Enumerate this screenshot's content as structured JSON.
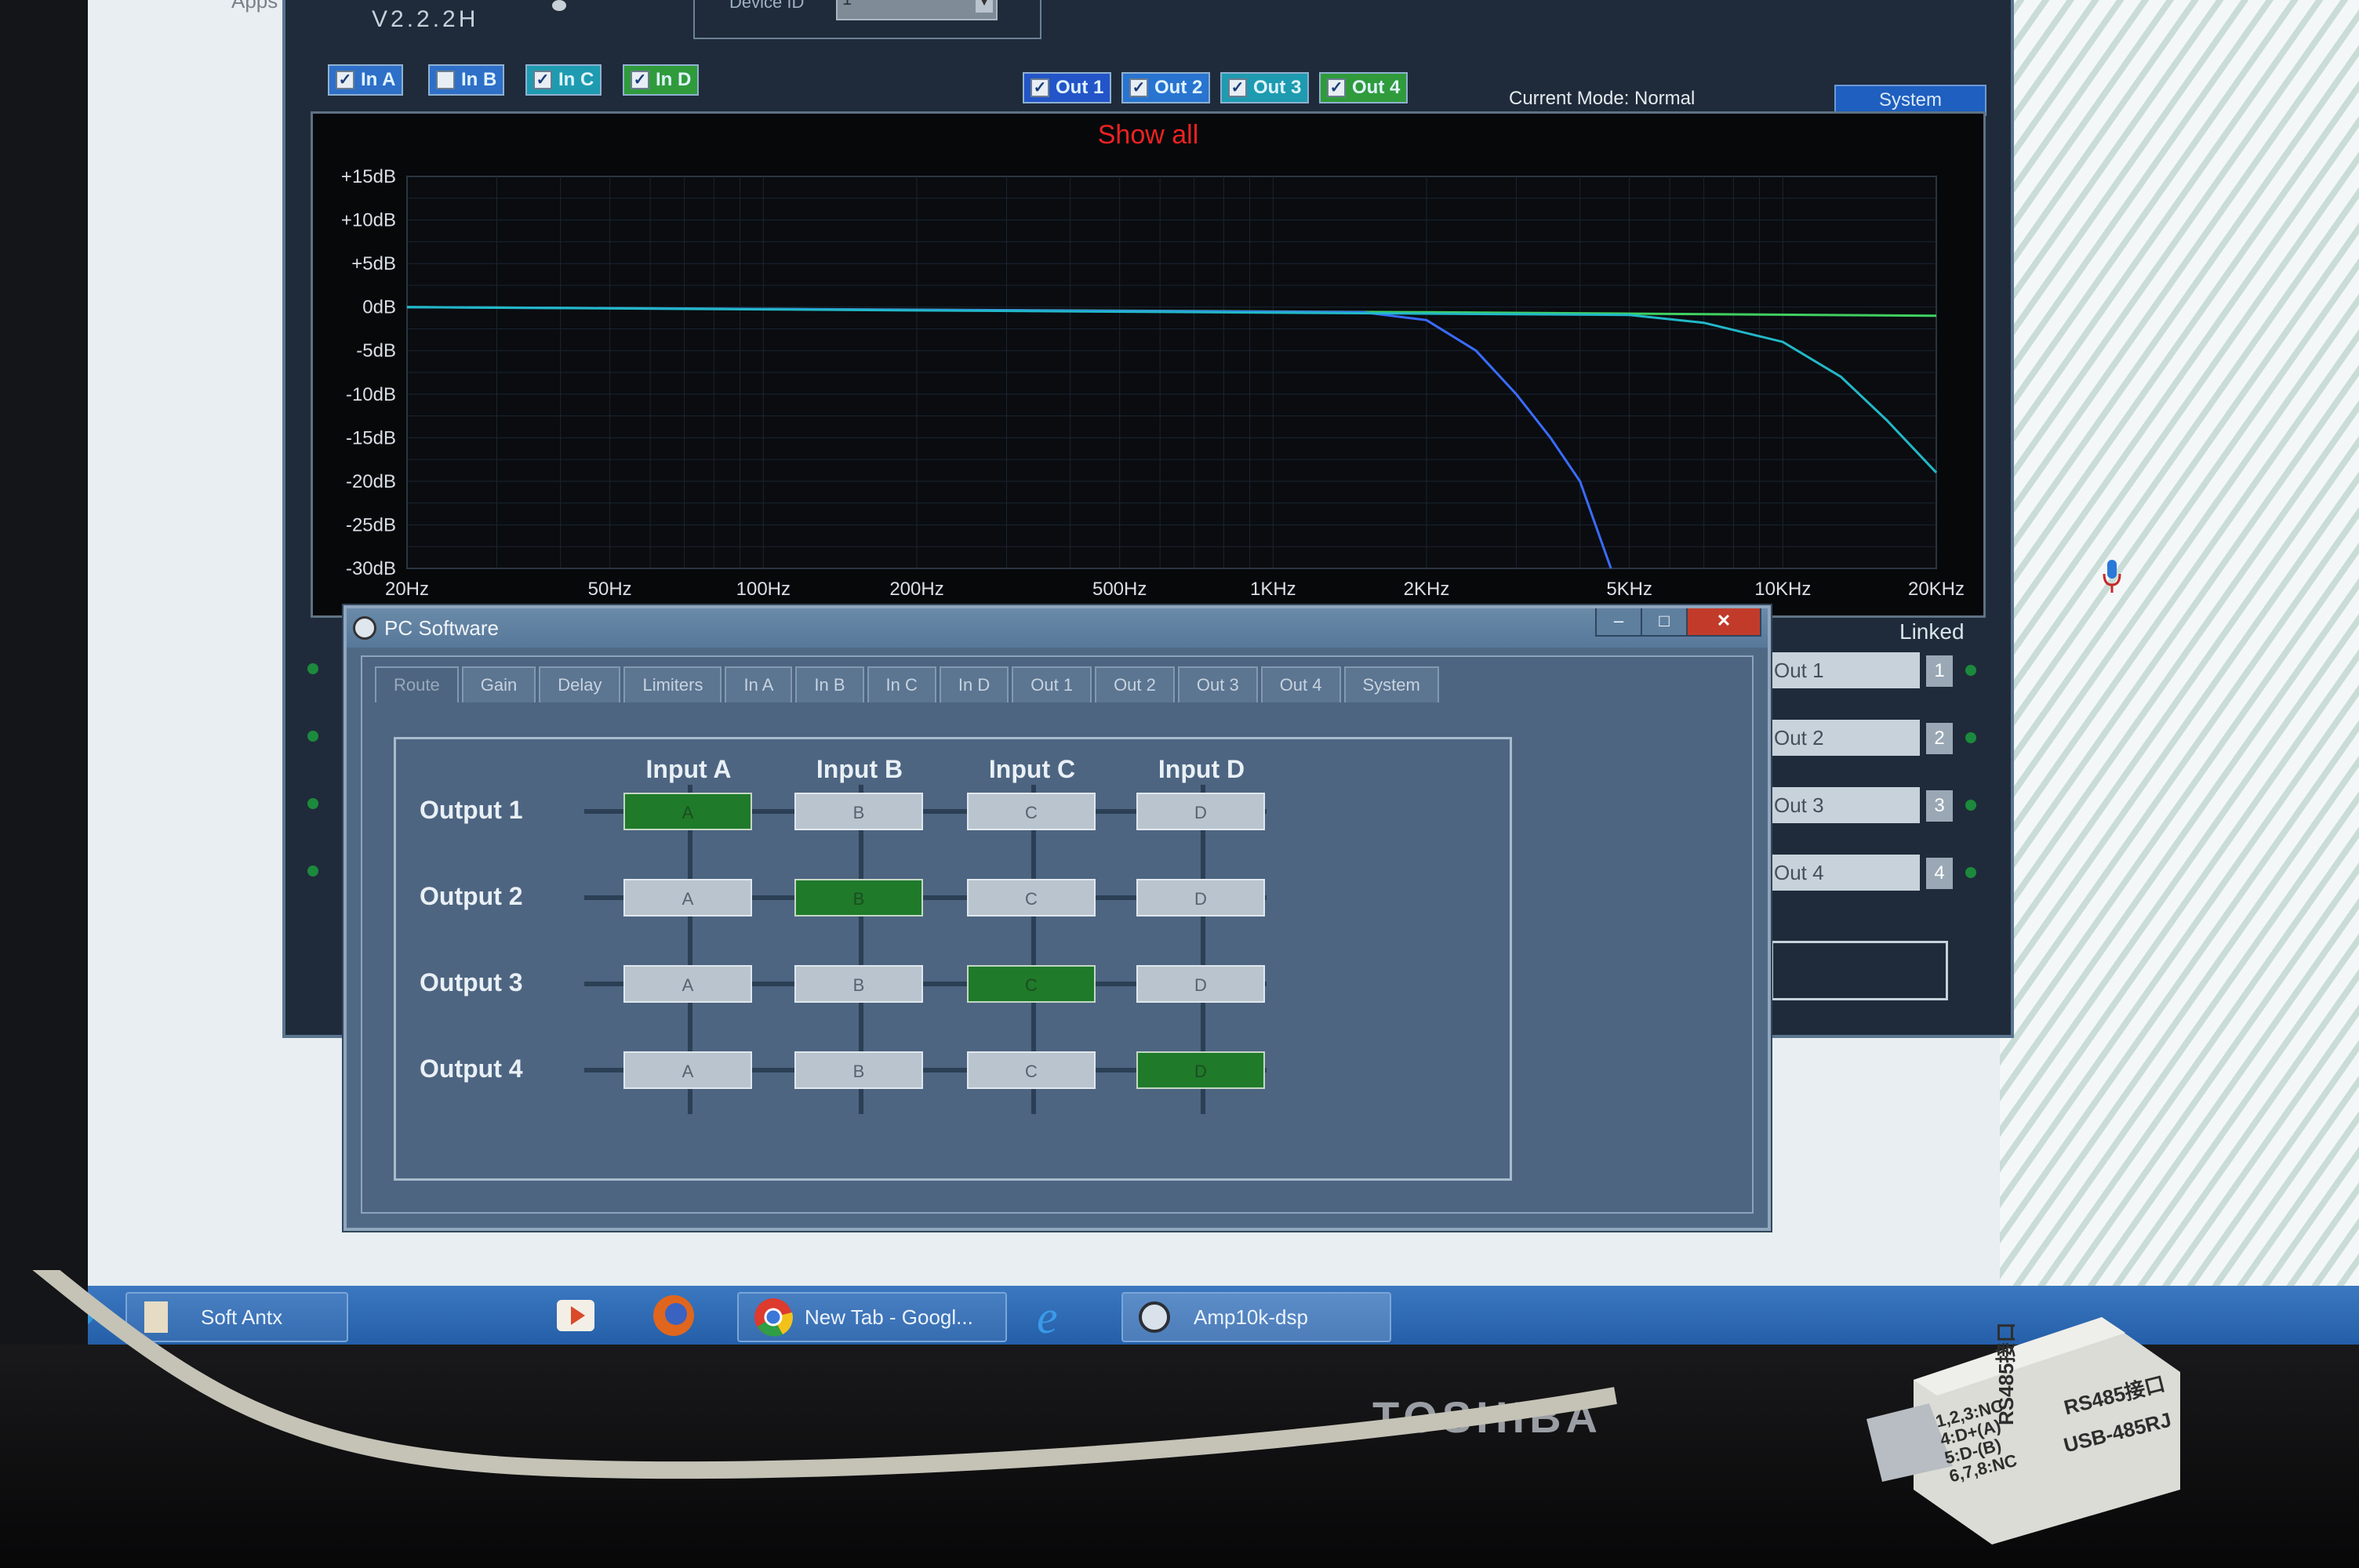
{
  "desktop": {
    "apps_label": "Apps"
  },
  "dsp_window": {
    "version": "V2.2.2H",
    "device_id_label": "Device ID",
    "device_id_value": "1",
    "inputs": [
      {
        "label": "In A",
        "checked": true,
        "color": "#2e6fc8"
      },
      {
        "label": "In B",
        "checked": false,
        "color": "#2e6fc8"
      },
      {
        "label": "In C",
        "checked": true,
        "color": "#1e9bb0"
      },
      {
        "label": "In D",
        "checked": true,
        "color": "#2f9b3b"
      }
    ],
    "outputs": [
      {
        "label": "Out 1",
        "checked": true,
        "color": "#2355c8"
      },
      {
        "label": "Out 2",
        "checked": true,
        "color": "#2874d0"
      },
      {
        "label": "Out 3",
        "checked": true,
        "color": "#1e9bb0"
      },
      {
        "label": "Out 4",
        "checked": true,
        "color": "#2f9b3b"
      }
    ],
    "current_mode_label": "Current Mode:",
    "current_mode_value": "Normal",
    "system_button": "System",
    "graph": {
      "show_all": "Show all",
      "y_labels": [
        "+15dB",
        "+10dB",
        "+5dB",
        "0dB",
        "-5dB",
        "-10dB",
        "-15dB",
        "-20dB",
        "-25dB",
        "-30dB"
      ],
      "x_labels": [
        "20Hz",
        "50Hz",
        "100Hz",
        "200Hz",
        "500Hz",
        "1KHz",
        "2KHz",
        "5KHz",
        "10KHz",
        "20KHz"
      ]
    },
    "linked_label": "Linked",
    "linked": [
      {
        "label": "Out 1",
        "num": "1"
      },
      {
        "label": "Out 2",
        "num": "2"
      },
      {
        "label": "Out 3",
        "num": "3"
      },
      {
        "label": "Out 4",
        "num": "4"
      }
    ]
  },
  "chart_data": {
    "type": "line",
    "ylim": [
      -30,
      15
    ],
    "xlim": [
      20,
      20000
    ],
    "x_scale": "log",
    "series": [
      {
        "color": "#40d060",
        "x": [
          20,
          200,
          2000,
          20000
        ],
        "y": [
          0,
          -0.3,
          -0.6,
          -1.0
        ]
      },
      {
        "color": "#3a6cff",
        "x": [
          20,
          1500,
          2000,
          2500,
          3000,
          3500,
          4000,
          4600
        ],
        "y": [
          0,
          -0.6,
          -1.5,
          -5,
          -10,
          -15,
          -20,
          -30
        ]
      },
      {
        "color": "#22b8c8",
        "x": [
          20,
          5000,
          7000,
          10000,
          13000,
          16000,
          20000
        ],
        "y": [
          0,
          -0.9,
          -1.8,
          -4,
          -8,
          -13,
          -19
        ]
      }
    ]
  },
  "dialog": {
    "title": "PC Software",
    "tabs": [
      "Route",
      "Gain",
      "Delay",
      "Limiters",
      "In A",
      "In B",
      "In C",
      "In D",
      "Out 1",
      "Out 2",
      "Out 3",
      "Out 4",
      "System"
    ],
    "active_tab": "Route",
    "columns": [
      "Input A",
      "Input B",
      "Input C",
      "Input D"
    ],
    "rows": [
      {
        "label": "Output 1",
        "cells": [
          "A",
          "B",
          "C",
          "D"
        ],
        "active": 0
      },
      {
        "label": "Output 2",
        "cells": [
          "A",
          "B",
          "C",
          "D"
        ],
        "active": 1
      },
      {
        "label": "Output 3",
        "cells": [
          "A",
          "B",
          "C",
          "D"
        ],
        "active": 2
      },
      {
        "label": "Output 4",
        "cells": [
          "A",
          "B",
          "C",
          "D"
        ],
        "active": 3
      }
    ]
  },
  "taskbar": {
    "items": [
      {
        "label": "Soft Antx"
      },
      {
        "label": "New Tab - Googl..."
      },
      {
        "label": "Amp10k-dsp"
      }
    ]
  },
  "monitor": {
    "brand": "TOSHIBA"
  },
  "adapter": {
    "pins": [
      "1,2,3:NC",
      "4:D+(A)",
      "5:D-(B)",
      "6,7,8:NC"
    ],
    "label1": "RS485接口",
    "label2": "RS485接口",
    "label3": "USB-485RJ"
  }
}
